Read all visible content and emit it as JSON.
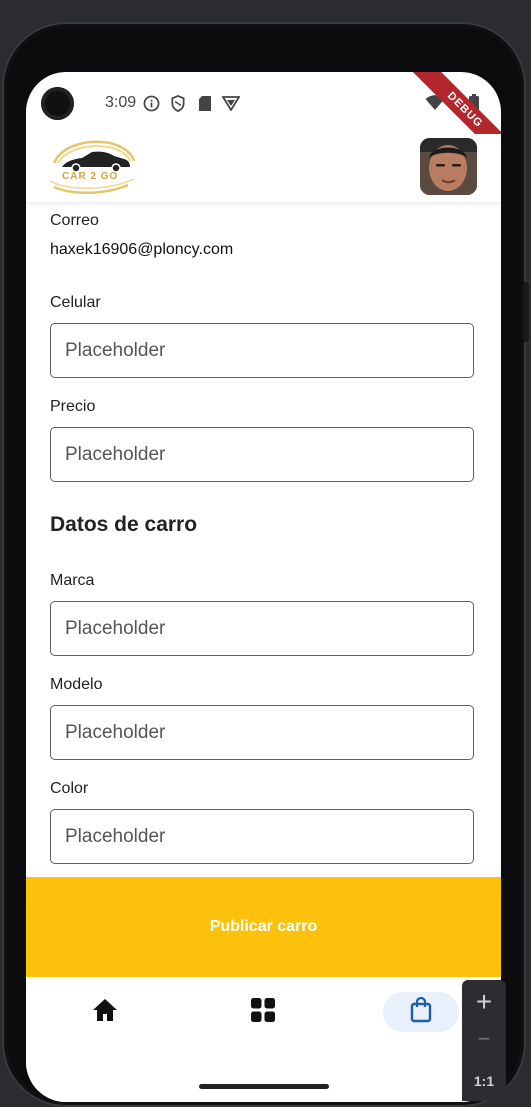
{
  "status_bar": {
    "time": "3:09",
    "icons": [
      "info-circle-icon",
      "shield-icon",
      "sd-card-icon",
      "vpn-icon"
    ],
    "right_icons": [
      "wifi-icon",
      "signal-icon",
      "battery-icon"
    ],
    "debug_banner": "DEBUG",
    "debug_color": "#b3262c"
  },
  "appbar": {
    "logo_text": "CAR 2 GO",
    "logo_color": "#d4a537"
  },
  "form": {
    "correo_label": "Correo",
    "correo_value": "haxek16906@ploncy.com",
    "celular_label": "Celular",
    "celular_placeholder": "Placeholder",
    "precio_label": "Precio",
    "precio_placeholder": "Placeholder",
    "section_title": "Datos de carro",
    "marca_label": "Marca",
    "marca_placeholder": "Placeholder",
    "modelo_label": "Modelo",
    "modelo_placeholder": "Placeholder",
    "color_label": "Color",
    "color_placeholder": "Placeholder"
  },
  "publish_button": {
    "label": "Publicar carro",
    "color": "#fcc10a"
  },
  "bottom_nav": {
    "items": [
      {
        "icon": "home-icon",
        "active": false
      },
      {
        "icon": "grid-icon",
        "active": false
      },
      {
        "icon": "shopping-bag-icon",
        "active": true
      }
    ],
    "active_color": "#1f5fa8"
  },
  "zoom_controls": {
    "zoom_in": "+",
    "zoom_out": "−",
    "reset": "1:1"
  }
}
